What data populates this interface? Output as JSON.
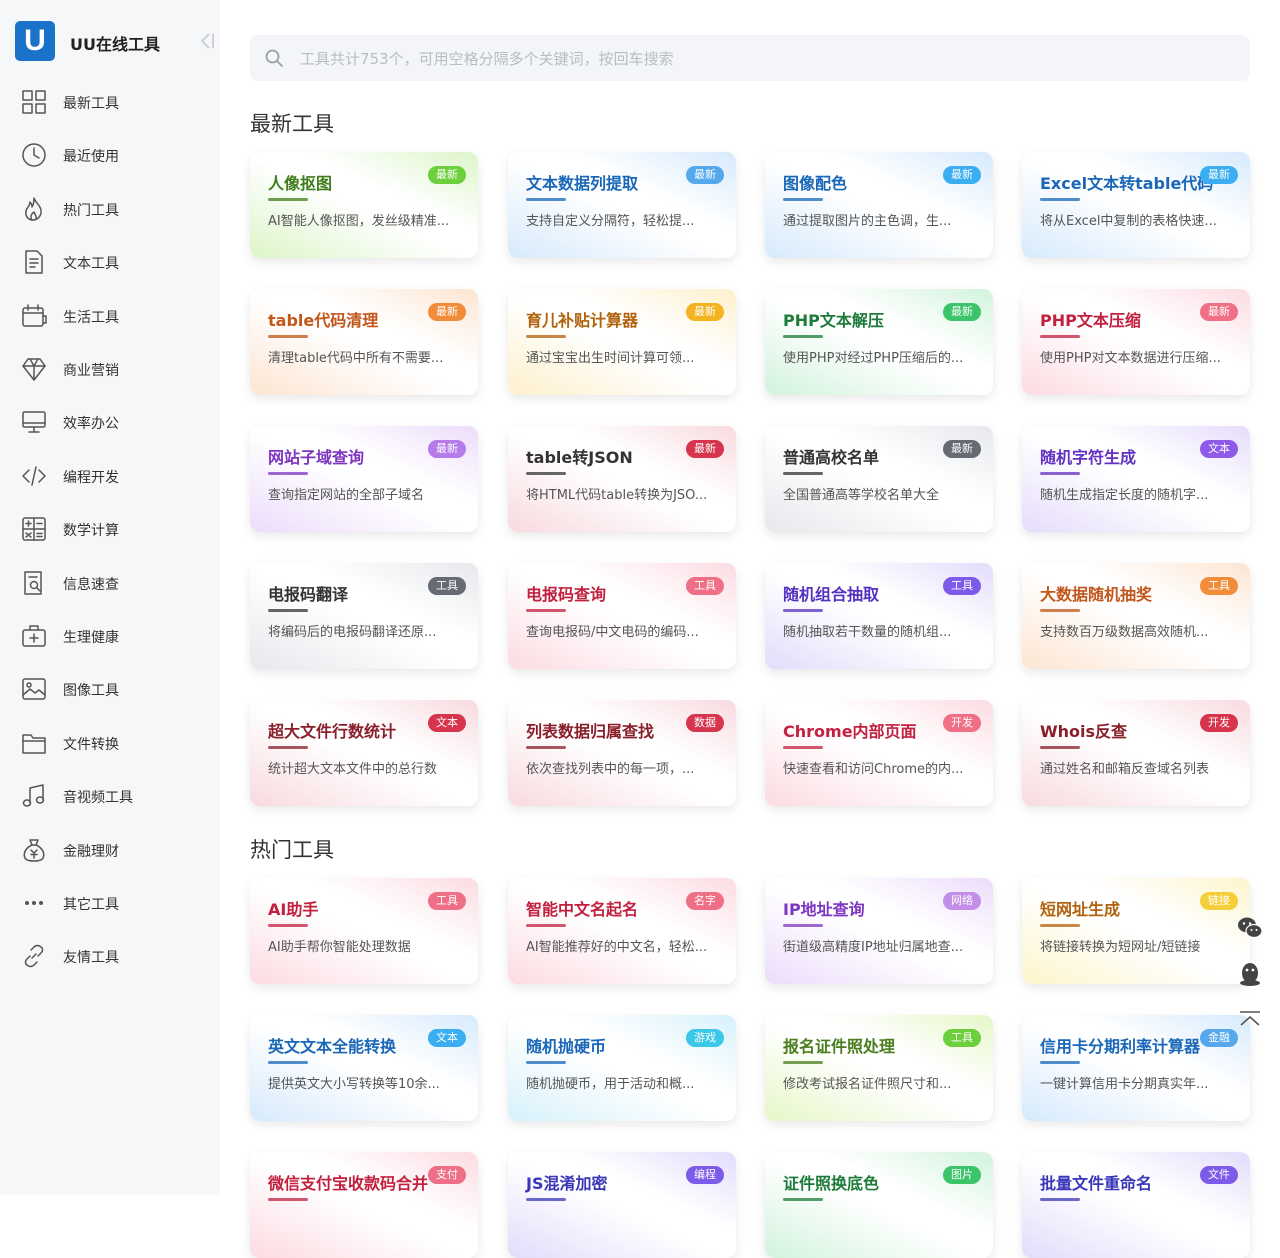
{
  "brand": {
    "name": "UU在线工具",
    "logo_letter": "U"
  },
  "sidebar": {
    "items": [
      {
        "label": "最新工具",
        "icon": "grid-icon"
      },
      {
        "label": "最近使用",
        "icon": "clock-icon"
      },
      {
        "label": "热门工具",
        "icon": "fire-icon"
      },
      {
        "label": "文本工具",
        "icon": "document-icon"
      },
      {
        "label": "生活工具",
        "icon": "calendar-icon"
      },
      {
        "label": "商业营销",
        "icon": "diamond-icon"
      },
      {
        "label": "效率办公",
        "icon": "monitor-icon"
      },
      {
        "label": "编程开发",
        "icon": "code-icon"
      },
      {
        "label": "数学计算",
        "icon": "calculator-icon"
      },
      {
        "label": "信息速查",
        "icon": "search-doc-icon"
      },
      {
        "label": "生理健康",
        "icon": "medical-kit-icon"
      },
      {
        "label": "图像工具",
        "icon": "image-icon"
      },
      {
        "label": "文件转换",
        "icon": "folder-icon"
      },
      {
        "label": "音视频工具",
        "icon": "music-note-icon"
      },
      {
        "label": "金融理财",
        "icon": "money-bag-icon"
      },
      {
        "label": "其它工具",
        "icon": "more-dots-icon"
      },
      {
        "label": "友情工具",
        "icon": "link-icon"
      }
    ]
  },
  "search": {
    "placeholder": "工具共计753个，可用空格分隔多个关键词，按回车搜索",
    "value": ""
  },
  "sections": [
    {
      "title": "最新工具",
      "cards": [
        {
          "name": "人像抠图",
          "desc": "AI智能人像抠图，发丝级精准...",
          "tag": "最新",
          "color": "#3f7d1c",
          "tag_color": "#6ccf3c",
          "tint": "#dcf5c8"
        },
        {
          "name": "文本数据列提取",
          "desc": "支持自定义分隔符，轻松提...",
          "tag": "最新",
          "color": "#1a67b8",
          "tag_color": "#55a8ec",
          "tint": "#d6eafc"
        },
        {
          "name": "图像配色",
          "desc": "通过提取图片的主色调，生...",
          "tag": "最新",
          "color": "#1a67b8",
          "tag_color": "#3aaef0",
          "tint": "#d6eafc"
        },
        {
          "name": "Excel文本转table代码",
          "desc": "将从Excel中复制的表格快速...",
          "tag": "最新",
          "color": "#1a67b8",
          "tag_color": "#3aaef0",
          "tint": "#d6eafc"
        },
        {
          "name": "table代码清理",
          "desc": "清理table代码中所有不需要...",
          "tag": "最新",
          "color": "#c2561b",
          "tag_color": "#f08c3a",
          "tint": "#fde5d2"
        },
        {
          "name": "育儿补贴计算器",
          "desc": "通过宝宝出生时间计算可领...",
          "tag": "最新",
          "color": "#b0620e",
          "tag_color": "#f4b320",
          "tint": "#fdf0cc"
        },
        {
          "name": "PHP文本解压",
          "desc": "使用PHP对经过PHP压缩后的...",
          "tag": "最新",
          "color": "#1d7a3a",
          "tag_color": "#3cc46a",
          "tint": "#d2f3dd"
        },
        {
          "name": "PHP文本压缩",
          "desc": "使用PHP对文本数据进行压缩...",
          "tag": "最新",
          "color": "#c2203e",
          "tag_color": "#ef6f86",
          "tint": "#fcdbe2"
        },
        {
          "name": "网站子域查询",
          "desc": "查询指定网站的全部子域名",
          "tag": "最新",
          "color": "#7d35c2",
          "tag_color": "#b57be8",
          "tint": "#ecdcfb"
        },
        {
          "name": "table转JSON",
          "desc": "将HTML代码table转换为JSO...",
          "tag": "最新",
          "color": "#333333",
          "tag_color": "#d6354d",
          "tint": "#f8dadf"
        },
        {
          "name": "普通高校名单",
          "desc": "全国普通高等学校名单大全",
          "tag": "最新",
          "color": "#333333",
          "tag_color": "#666a73",
          "tint": "#e6e8ec"
        },
        {
          "name": "随机字符生成",
          "desc": "随机生成指定长度的随机字...",
          "tag": "文本",
          "color": "#6230c2",
          "tag_color": "#8e5ae8",
          "tint": "#e5dcfb"
        },
        {
          "name": "电报码翻译",
          "desc": "将编码后的电报码翻译还原...",
          "tag": "工具",
          "color": "#333333",
          "tag_color": "#666a73",
          "tint": "#e6e8ec"
        },
        {
          "name": "电报码查询",
          "desc": "查询电报码/中文电码的编码...",
          "tag": "工具",
          "color": "#c2203e",
          "tag_color": "#ef6f86",
          "tint": "#fcdbe2"
        },
        {
          "name": "随机组合抽取",
          "desc": "随机抽取若干数量的随机组...",
          "tag": "工具",
          "color": "#5430c2",
          "tag_color": "#7e5ae8",
          "tint": "#e2dcfb"
        },
        {
          "name": "大数据随机抽奖",
          "desc": "支持数百万级数据高效随机...",
          "tag": "工具",
          "color": "#c2561b",
          "tag_color": "#f08c3a",
          "tint": "#fde5d2"
        },
        {
          "name": "超大文件行数统计",
          "desc": "统计超大文本文件中的总行数",
          "tag": "文本",
          "color": "#8a1f2a",
          "tag_color": "#d6354d",
          "tint": "#f8dadf"
        },
        {
          "name": "列表数据归属查找",
          "desc": "依次查找列表中的每一项，...",
          "tag": "数据",
          "color": "#8a1f2a",
          "tag_color": "#d6354d",
          "tint": "#f8dadf"
        },
        {
          "name": "Chrome内部页面",
          "desc": "快速查看和访问Chrome的内...",
          "tag": "开发",
          "color": "#c2203e",
          "tag_color": "#ef6f86",
          "tint": "#fcdbe2"
        },
        {
          "name": "Whois反查",
          "desc": "通过姓名和邮箱反查域名列表",
          "tag": "开发",
          "color": "#8a1f2a",
          "tag_color": "#d6354d",
          "tint": "#f8dadf"
        }
      ]
    },
    {
      "title": "热门工具",
      "cards": [
        {
          "name": "AI助手",
          "desc": "AI助手帮你智能处理数据",
          "tag": "工具",
          "color": "#c2203e",
          "tag_color": "#ef6f86",
          "tint": "#fcdbe2"
        },
        {
          "name": "智能中文名起名",
          "desc": "AI智能推荐好的中文名，轻松...",
          "tag": "名字",
          "color": "#c2203e",
          "tag_color": "#ef6f86",
          "tint": "#fcdbe2"
        },
        {
          "name": "IP地址查询",
          "desc": "街道级高精度IP地址归属地查...",
          "tag": "网络",
          "color": "#7d35c2",
          "tag_color": "#c38ee8",
          "tint": "#ecdcfb"
        },
        {
          "name": "短网址生成",
          "desc": "将链接转换为短网址/短链接",
          "tag": "链接",
          "color": "#b0620e",
          "tag_color": "#f5cf3a",
          "tint": "#fdf5cc"
        },
        {
          "name": "英文文本全能转换",
          "desc": "提供英文大小写转换等10余...",
          "tag": "文本",
          "color": "#1a67b8",
          "tag_color": "#3aaef0",
          "tint": "#d6eafc"
        },
        {
          "name": "随机抛硬币",
          "desc": "随机抛硬币，用于活动和概...",
          "tag": "游戏",
          "color": "#1a67b8",
          "tag_color": "#3ac8e8",
          "tint": "#d6f1fb"
        },
        {
          "name": "报名证件照处理",
          "desc": "修改考试报名证件照尺寸和...",
          "tag": "工具",
          "color": "#4a7d1c",
          "tag_color": "#6ccf3c",
          "tint": "#e6f7c8"
        },
        {
          "name": "信用卡分期利率计算器",
          "desc": "一键计算信用卡分期真实年...",
          "tag": "金融",
          "color": "#1a67b8",
          "tag_color": "#55a8ec",
          "tint": "#d6eafc"
        },
        {
          "name": "微信支付宝收款码合并",
          "desc": "",
          "tag": "支付",
          "color": "#c2203e",
          "tag_color": "#ef6f86",
          "tint": "#fcdbe2"
        },
        {
          "name": "JS混淆加密",
          "desc": "",
          "tag": "编程",
          "color": "#3a36b8",
          "tag_color": "#7e5ae8",
          "tint": "#e2dcfb"
        },
        {
          "name": "证件照换底色",
          "desc": "",
          "tag": "图片",
          "color": "#1d7a3a",
          "tag_color": "#3cc46a",
          "tint": "#d2f3dd"
        },
        {
          "name": "批量文件重命名",
          "desc": "",
          "tag": "文件",
          "color": "#3a36b8",
          "tag_color": "#7e5ae8",
          "tint": "#e2dcfb"
        }
      ]
    }
  ],
  "float_tools": [
    {
      "icon": "wechat-icon"
    },
    {
      "icon": "qq-icon"
    },
    {
      "icon": "back-to-top-icon"
    }
  ]
}
